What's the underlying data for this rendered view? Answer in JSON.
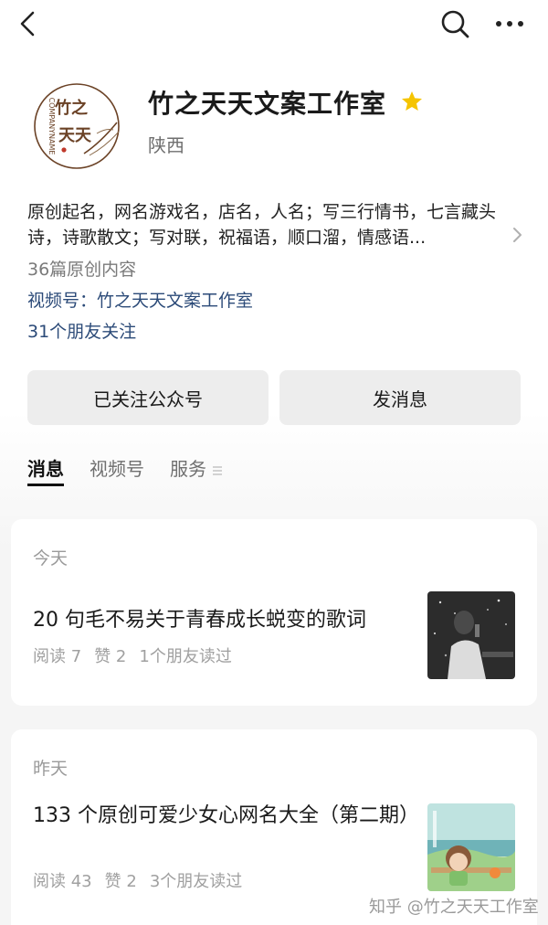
{
  "nav": {
    "back_icon": "back-arrow-icon",
    "search_icon": "search-icon",
    "more_icon": "more-dots-icon"
  },
  "profile": {
    "logo_text_top": "竹之",
    "logo_text_bottom": "天天",
    "logo_text_side": "COMPANYNAME",
    "name": "竹之天天文案工作室",
    "star_color": "#f5c400",
    "location": "陕西",
    "description": "原创起名，网名游戏名，店名，人名；写三行情书，七言藏头诗，诗歌散文；写对联，祝福语，顺口溜，情感语...",
    "article_count": "36篇原创内容",
    "channel": "视频号：竹之天天文案工作室",
    "friends_follow": "31个朋友关注"
  },
  "actions": {
    "follow_label": "已关注公众号",
    "message_label": "发消息"
  },
  "tabs": [
    {
      "label": "消息",
      "active": true
    },
    {
      "label": "视频号",
      "active": false
    },
    {
      "label": "服务",
      "active": false
    }
  ],
  "articles": [
    {
      "date": "今天",
      "title": "20 句毛不易关于青春成长蜕变的歌词",
      "reads": "阅读 7",
      "likes": "赞 2",
      "friends_read": "1个朋友读过"
    },
    {
      "date": "昨天",
      "title": "133 个原创可爱少女心网名大全（第二期）",
      "reads": "阅读 43",
      "likes": "赞 2",
      "friends_read": "3个朋友读过"
    }
  ],
  "watermark": "知乎 @竹之天天工作室",
  "colors": {
    "link": "#2b4a78",
    "muted": "#9a9a9a",
    "brand": "#6b4226"
  }
}
